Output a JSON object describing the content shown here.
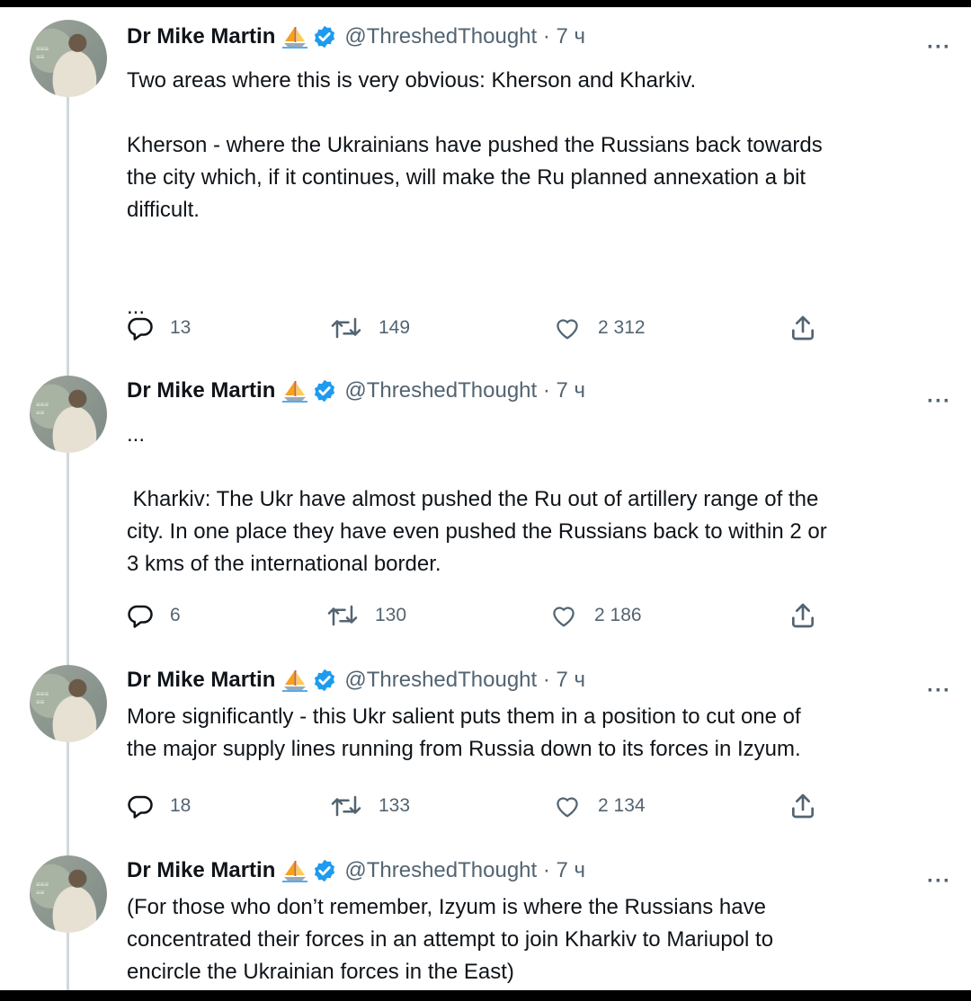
{
  "tweets": [
    {
      "author": "Dr Mike Martin",
      "handle_time": "@ThreshedThought · 7 ч",
      "text": "Two areas where this is very obvious: Kherson and Kharkiv.\n\nKherson - where the Ukrainians have pushed the Russians back towards\nthe city which, if it continues, will make the Ru planned annexation a bit\ndifficult.\n\n\n...",
      "replies": "13",
      "retweets": "149",
      "likes": "2 312"
    },
    {
      "author": "Dr Mike Martin",
      "handle_time": "@ThreshedThought · 7 ч",
      "text": "...\n\n Kharkiv: The Ukr have almost pushed the Ru out of artillery range of the\ncity. In one place they have even pushed the Russians back to within 2 or\n3 kms of the international border.",
      "replies": "6",
      "retweets": "130",
      "likes": "2 186"
    },
    {
      "author": "Dr Mike Martin",
      "handle_time": "@ThreshedThought · 7 ч",
      "text": "More significantly - this Ukr salient puts them in a position to cut one of\nthe major supply lines running from Russia down to its forces in Izyum.",
      "replies": "18",
      "retweets": "133",
      "likes": "2 134"
    },
    {
      "author": "Dr Mike Martin",
      "handle_time": "@ThreshedThought · 7 ч",
      "text": "(For those who don’t remember, Izyum is where the Russians have\nconcentrated their forces in an attempt to join Kharkiv to Mariupol to\nencircle the Ukrainian forces in the East)"
    }
  ],
  "more_label": "···",
  "icons": {
    "avatar": "profile-photo",
    "emoji": "sailboat-emoji",
    "verified": "verified-badge-icon",
    "reply": "reply-icon",
    "retweet": "retweet-icon",
    "like": "heart-icon",
    "share": "share-icon"
  },
  "colors": {
    "text": "#0f1419",
    "secondary": "#536471",
    "verified": "#1d9bf0",
    "thread_line": "#cfd9de"
  }
}
